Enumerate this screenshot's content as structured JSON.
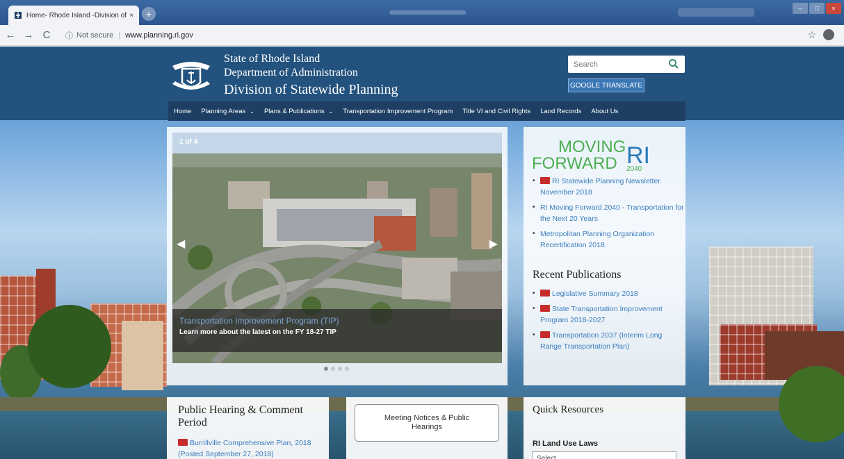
{
  "browser": {
    "tab_title": "Home- Rhode Island -Division of",
    "tab_close": "×",
    "new_tab": "+",
    "security": "Not secure",
    "url": "www.planning.ri.gov"
  },
  "header": {
    "line1": "State of Rhode Island",
    "line2": "Department of Administration",
    "line3": "Division of Statewide Planning",
    "search_placeholder": "Search",
    "translate_label": "GOOGLE TRANSLATE"
  },
  "nav": [
    {
      "label": "Home",
      "caret": false
    },
    {
      "label": "Planning Areas",
      "caret": true
    },
    {
      "label": "Plans & Publications",
      "caret": true
    },
    {
      "label": "Transportation Improvement Program",
      "caret": false
    },
    {
      "label": "Title VI and Civil Rights",
      "caret": false
    },
    {
      "label": "Land Records",
      "caret": false
    },
    {
      "label": "About Us",
      "caret": false
    }
  ],
  "slider": {
    "counter": "1 of 4",
    "caption_title": "Transportation Improvement Program (TIP)",
    "caption_sub": "Learn more about the latest on the FY 18-27 TIP",
    "dots": 4,
    "active_dot": 1
  },
  "moving_forward": {
    "logo_line1": "MOVING",
    "logo_line2": "FORWARD",
    "logo_ri": "RI",
    "logo_year": "2040",
    "items": [
      {
        "text": "RI Statewide Planning Newsletter November 2018",
        "pdf": true
      },
      {
        "text": "RI Moving Forward 2040 - Transportation for the Next 20 Years",
        "pdf": false
      },
      {
        "text": "Metropolitan Planning Organization Recertification 2018",
        "pdf": false
      }
    ]
  },
  "recent_publications": {
    "heading": "Recent Publications",
    "items": [
      {
        "text": "Legislative Summary 2018",
        "pdf": true
      },
      {
        "text": "State Transportation Improvement Program 2018-2027",
        "pdf": true
      },
      {
        "text": "Transportation 2037 (Interim Long Range Transportation Plan)",
        "pdf": true
      }
    ]
  },
  "public_hearing": {
    "title": "Public Hearing & Comment Period",
    "link": "Burrillville Comprehensive Plan, 2018 (Posted September 27, 2018)"
  },
  "meeting_notices": {
    "button": "Meeting Notices & Public Hearings"
  },
  "quick_resources": {
    "title": "Quick Resources",
    "subtitle": "RI Land Use Laws",
    "select_value": "Select"
  },
  "colors": {
    "header_blue": "#23527e",
    "nav_dark": "#1e3f63",
    "link_blue": "#3b7dbd",
    "logo_green": "#4caf50",
    "logo_blue": "#2a7ab8"
  }
}
